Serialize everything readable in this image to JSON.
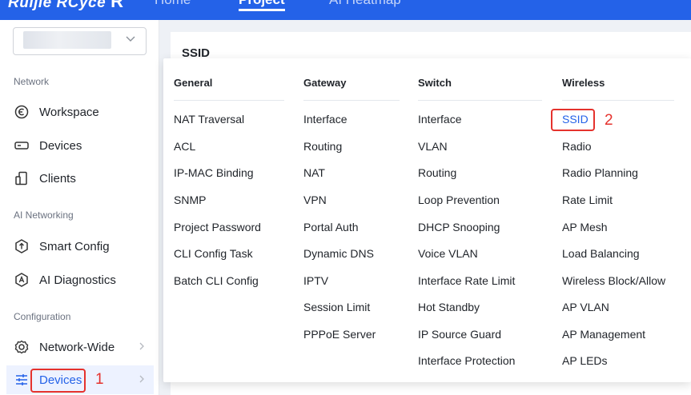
{
  "topbar": {
    "logo_text": "Ruijie RCyce",
    "logo_mark": "R",
    "tabs": [
      "Home",
      "Project",
      "AI Heatmap"
    ],
    "active_tab": "Project",
    "colors": {
      "bar": "#2462e8"
    }
  },
  "sidebar": {
    "project_select": {
      "value": "",
      "icon": "chevron-down-icon"
    },
    "sections": [
      {
        "title": "Network",
        "items": [
          {
            "label": "Workspace",
            "icon": "workspace-icon"
          },
          {
            "label": "Devices",
            "icon": "devices-icon"
          },
          {
            "label": "Clients",
            "icon": "clients-icon"
          }
        ]
      },
      {
        "title": "AI Networking",
        "items": [
          {
            "label": "Smart Config",
            "icon": "smart-config-icon"
          },
          {
            "label": "AI Diagnostics",
            "icon": "ai-diagnostics-icon"
          }
        ]
      },
      {
        "title": "Configuration",
        "items": [
          {
            "label": "Network-Wide",
            "icon": "gear-icon",
            "expandable": true
          },
          {
            "label": "Devices",
            "icon": "sliders-icon",
            "expandable": true,
            "active": true
          }
        ]
      }
    ]
  },
  "main": {
    "title": "SSID"
  },
  "menu": {
    "columns": [
      {
        "header": "General",
        "items": [
          "NAT Traversal",
          "ACL",
          "IP-MAC Binding",
          "SNMP",
          "Project Password",
          "CLI Config Task",
          "Batch CLI Config"
        ]
      },
      {
        "header": "Gateway",
        "items": [
          "Interface",
          "Routing",
          "NAT",
          "VPN",
          "Portal Auth",
          "Dynamic DNS",
          "IPTV",
          "Session Limit",
          "PPPoE Server"
        ]
      },
      {
        "header": "Switch",
        "items": [
          "Interface",
          "VLAN",
          "Routing",
          "Loop Prevention",
          "DHCP Snooping",
          "Voice VLAN",
          "Interface Rate Limit",
          "Hot Standby",
          "IP Source Guard",
          "Interface Protection"
        ]
      },
      {
        "header": "Wireless",
        "items": [
          "SSID",
          "Radio",
          "Radio Planning",
          "Rate Limit",
          "AP Mesh",
          "Load Balancing",
          "Wireless Block/Allow",
          "AP VLAN",
          "AP Management",
          "AP LEDs"
        ]
      }
    ]
  },
  "annotations": {
    "step1": "1",
    "step2": "2",
    "color": "#e5322d"
  }
}
